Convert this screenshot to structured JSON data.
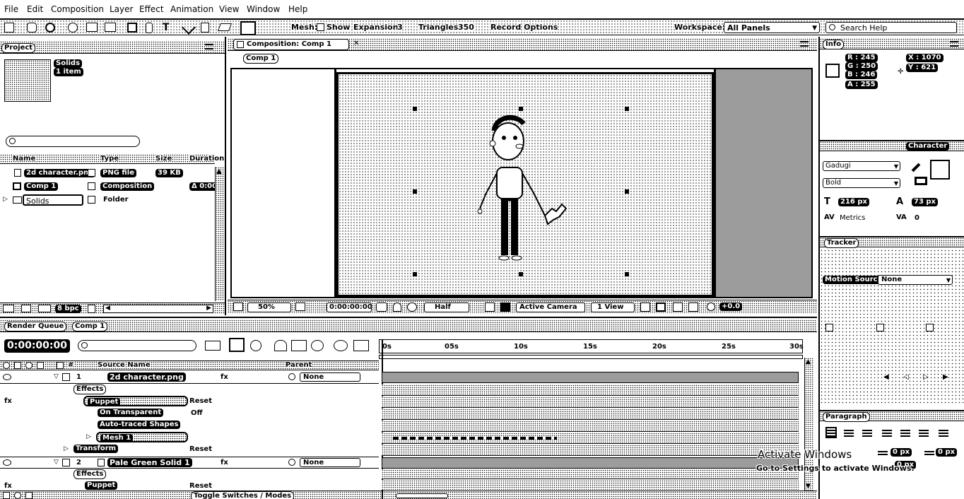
{
  "menu": [
    "File",
    "Edit",
    "Composition",
    "Layer",
    "Effect",
    "Animation",
    "View",
    "Window",
    "Help"
  ],
  "toolbar": {
    "mesh_label": "Mesh:",
    "show_label": "Show",
    "expansion_label": "Expansion:",
    "expansion_value": "3",
    "triangles_label": "Triangles:",
    "triangles_value": "350",
    "record_options": "Record Options",
    "workspace_label": "Workspace:",
    "workspace_value": "All Panels",
    "search_placeholder": "Search Help"
  },
  "project": {
    "tab_label": "Project",
    "thumb_name": "Solids",
    "thumb_info": "1 item",
    "columns": [
      "Name",
      "Type",
      "Size",
      "Duration"
    ],
    "items": [
      {
        "name": "2d character.png",
        "type": "PNG file",
        "size": "39 KB",
        "duration": ""
      },
      {
        "name": "Comp 1",
        "type": "Composition",
        "size": "",
        "duration": "Δ 0:00"
      },
      {
        "name": "Solids",
        "type": "Folder",
        "size": "",
        "duration": ""
      }
    ],
    "bpc": "8 bpc"
  },
  "viewer": {
    "tab_label": "Composition: Comp 1",
    "comp_button": "Comp 1",
    "zoom": "50%",
    "timecode": "0:00:00:00",
    "resolution": "Half",
    "camera": "Active Camera",
    "view": "1 View",
    "exposure": "+0.0"
  },
  "info": {
    "tab_label": "Info",
    "r": "R : 245",
    "g": "G : 250",
    "b": "B : 246",
    "a": "A : 255",
    "x": "X : 1070",
    "y": "Y : 621"
  },
  "character": {
    "tab_label": "Character",
    "font": "Gadugi",
    "style": "Bold",
    "size": "216 px",
    "leading": "73 px",
    "kerning": "Metrics",
    "tracking": "0"
  },
  "tracker": {
    "tab_label": "Tracker",
    "motion_source_label": "Motion Source:",
    "motion_source_value": "None"
  },
  "paragraph": {
    "tab_label": "Paragraph",
    "indent1": "0 px",
    "indent2": "0 px",
    "indent3": "0 px"
  },
  "timeline": {
    "tabs": [
      "Render Queue",
      "Comp 1"
    ],
    "timecode": "0:00:00:00",
    "search_placeholder": "",
    "ruler": [
      "0s",
      "05s",
      "10s",
      "15s",
      "20s",
      "25s",
      "30s"
    ],
    "col_headers": [
      "#",
      "Source Name",
      "Parent"
    ],
    "layers": [
      {
        "num": "1",
        "name": "2d character.png",
        "parent": "None"
      },
      {
        "num": "2",
        "name": "Pale Green Solid 1",
        "parent": "None"
      }
    ],
    "props": [
      {
        "label": "Effects",
        "value": ""
      },
      {
        "label": "Puppet",
        "value": "Reset"
      },
      {
        "label": "On Transparent",
        "value": "Off"
      },
      {
        "label": "Auto-traced Shapes",
        "value": ""
      },
      {
        "label": "Mesh 1",
        "value": ""
      },
      {
        "label": "Transform",
        "value": "Reset"
      },
      {
        "label": "Effects",
        "value": ""
      },
      {
        "label": "Puppet",
        "value": "Reset"
      }
    ],
    "toggle_label": "Toggle Switches / Modes"
  },
  "watermark": {
    "line1": "Activate Windows",
    "line2": "Go to Settings to activate Windows."
  }
}
